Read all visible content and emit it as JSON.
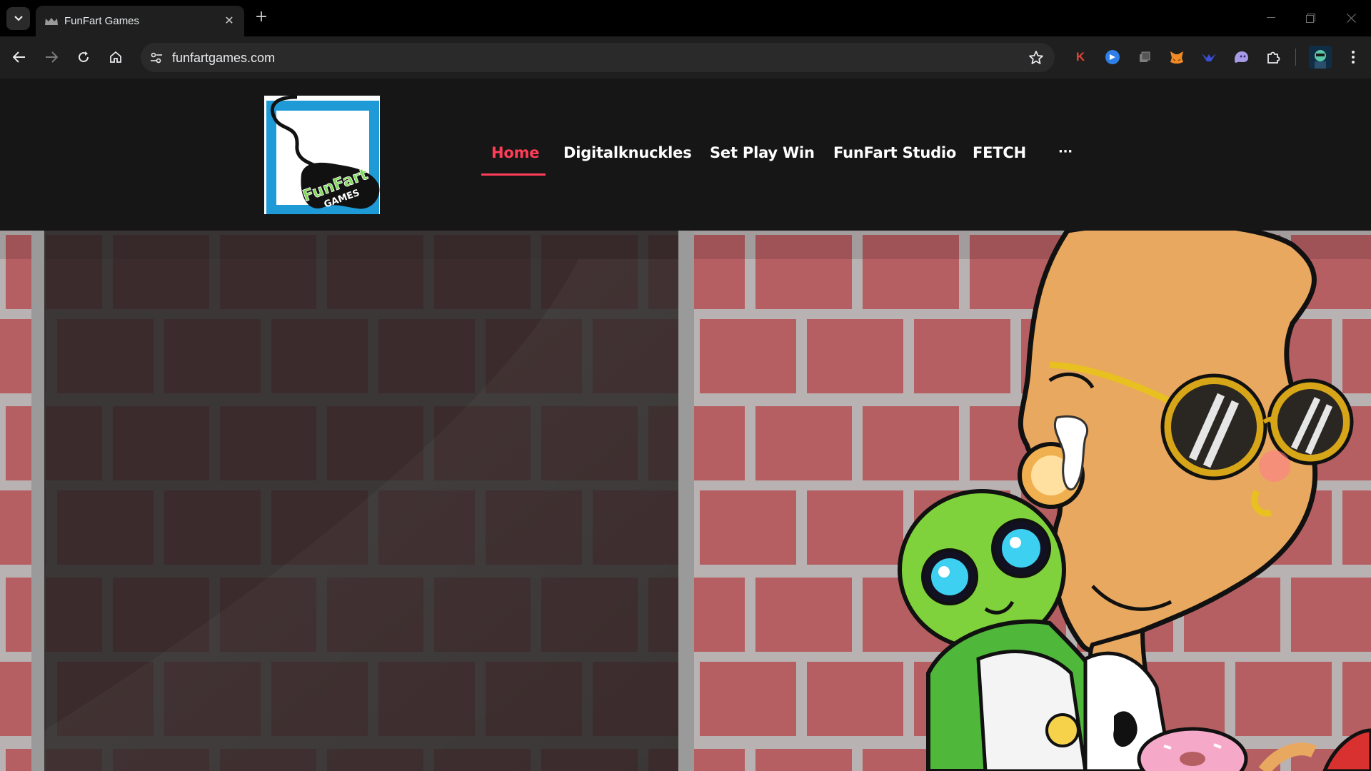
{
  "browser": {
    "tab_title": "FunFart Games",
    "url": "funfartgames.com",
    "extensions": [
      "k-extension-icon",
      "blue-circle-extension-icon",
      "copy-extension-icon",
      "fox-wallet-icon",
      "bird-extension-icon",
      "ghost-extension-icon",
      "puzzle-extensions-icon",
      "profile-avatar"
    ]
  },
  "site": {
    "logo_text_line1": "FunFart",
    "logo_text_line2": "GAMES",
    "nav": [
      {
        "label": "Home",
        "active": true
      },
      {
        "label": "Digitalknuckles",
        "active": false
      },
      {
        "label": "Set Play Win",
        "active": false
      },
      {
        "label": "FunFart Studio",
        "active": false
      },
      {
        "label": "FETCH",
        "active": false
      },
      {
        "label": "···",
        "active": false
      }
    ]
  },
  "colors": {
    "accent": "#ff3d57",
    "header_bg": "#161616",
    "brick": "#b55f62",
    "mortar": "#b9b2b2",
    "skin": "#e9a85f"
  }
}
